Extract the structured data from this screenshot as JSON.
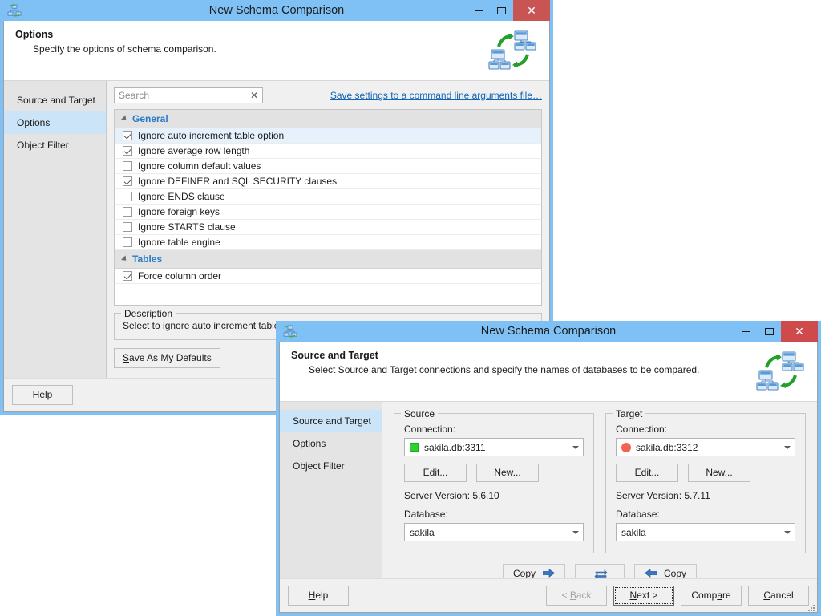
{
  "back_window": {
    "title": "New Schema Comparison",
    "icon": "schema-compare-icon",
    "controls": {
      "minimize": "–",
      "maximize": "□",
      "close": "✕"
    },
    "banner": {
      "title": "Options",
      "subtitle": "Specify the options of schema comparison.",
      "art": "schema-sync-illustration"
    },
    "nav": {
      "items": [
        {
          "label": "Source and Target",
          "selected": false
        },
        {
          "label": "Options",
          "selected": true
        },
        {
          "label": "Object Filter",
          "selected": false
        }
      ]
    },
    "search": {
      "placeholder": "Search",
      "value": "",
      "clear_label": "✕"
    },
    "command_link": "Save settings to a command line arguments file…",
    "option_groups": [
      {
        "name": "General",
        "expanded": true,
        "options": [
          {
            "label": "Ignore auto increment table option",
            "checked": true,
            "highlighted": true
          },
          {
            "label": "Ignore average row length",
            "checked": true,
            "highlighted": false
          },
          {
            "label": "Ignore column default values",
            "checked": false,
            "highlighted": false
          },
          {
            "label": "Ignore DEFINER and SQL SECURITY clauses",
            "checked": true,
            "highlighted": false
          },
          {
            "label": "Ignore ENDS clause",
            "checked": false,
            "highlighted": false
          },
          {
            "label": "Ignore foreign keys",
            "checked": false,
            "highlighted": false
          },
          {
            "label": "Ignore STARTS clause",
            "checked": false,
            "highlighted": false
          },
          {
            "label": "Ignore table engine",
            "checked": false,
            "highlighted": false
          }
        ]
      },
      {
        "name": "Tables",
        "expanded": true,
        "options": [
          {
            "label": "Force column order",
            "checked": true,
            "highlighted": false
          }
        ]
      }
    ],
    "description": {
      "legend": "Description",
      "text": "Select to ignore auto increment table opti"
    },
    "save_defaults_label": "Save As My Defaults",
    "footer": {
      "help_label": "Help"
    }
  },
  "front_window": {
    "title": "New Schema Comparison",
    "icon": "schema-compare-icon",
    "controls": {
      "minimize": "–",
      "maximize": "□",
      "close": "✕"
    },
    "banner": {
      "title": "Source and Target",
      "subtitle": "Select Source and Target connections and specify the names of databases to be compared.",
      "art": "schema-sync-illustration"
    },
    "nav": {
      "items": [
        {
          "label": "Source and Target",
          "selected": true
        },
        {
          "label": "Options",
          "selected": false
        },
        {
          "label": "Object Filter",
          "selected": false
        }
      ]
    },
    "source": {
      "legend": "Source",
      "connection_label": "Connection:",
      "connection_value": "sakila.db:3311",
      "status_indicator": "green-square",
      "status_color": "#2fd02f",
      "edit_label": "Edit...",
      "new_label": "New...",
      "server_version": "Server Version: 5.6.10",
      "database_label": "Database:",
      "database_value": "sakila"
    },
    "target": {
      "legend": "Target",
      "connection_label": "Connection:",
      "connection_value": "sakila.db:3312",
      "status_indicator": "red-circle",
      "status_color": "#f4634e",
      "edit_label": "Edit...",
      "new_label": "New...",
      "server_version": "Server Version: 5.7.11",
      "database_label": "Database:",
      "database_value": "sakila"
    },
    "transfer": {
      "copy_right_label": "Copy",
      "swap_label": "",
      "copy_left_label": "Copy",
      "arrow_color": "#2b6cb8"
    },
    "footer": {
      "help_label": "Help",
      "back_label": "< Back",
      "back_disabled": true,
      "next_label": "Next >",
      "next_focused": true,
      "compare_label": "Compare",
      "cancel_label": "Cancel"
    }
  }
}
